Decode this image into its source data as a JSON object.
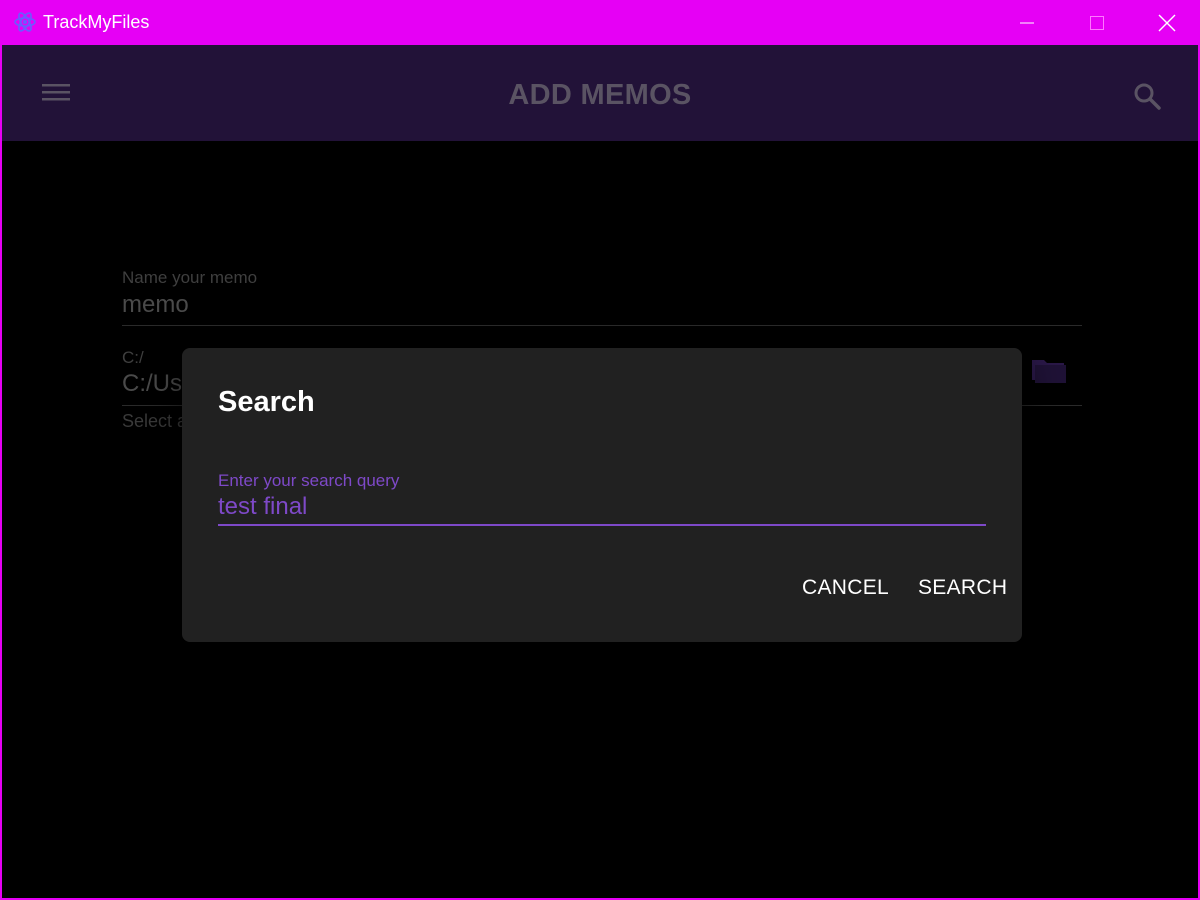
{
  "window": {
    "title": "TrackMyFiles",
    "icons": {
      "app": "atom-logo-icon",
      "minimize": "minimize-icon",
      "maximize": "maximize-icon",
      "close": "close-icon"
    },
    "accent": "#e600f5"
  },
  "appbar": {
    "title": "ADD MEMOS",
    "menu_icon": "hamburger-menu-icon",
    "search_icon": "search-icon",
    "background": "#221238"
  },
  "form": {
    "memo_name": {
      "label": "Name your memo",
      "value": "memo"
    },
    "path": {
      "label": "C:/",
      "value": "C:/Us",
      "folder_icon": "folder-icon"
    },
    "helper_text": "Select a"
  },
  "dialog": {
    "title": "Search",
    "input": {
      "label": "Enter your search query",
      "value": "test final"
    },
    "cancel_label": "CANCEL",
    "search_label": "SEARCH",
    "accent": "#7e49c8"
  }
}
